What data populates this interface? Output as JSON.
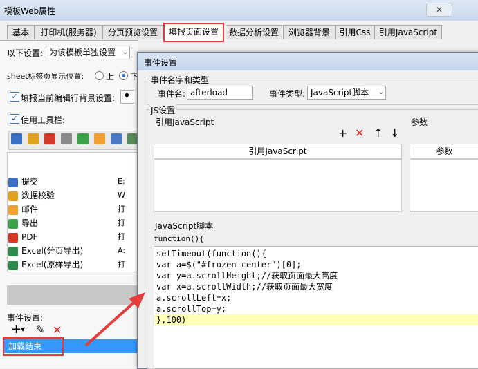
{
  "window": {
    "title": "模板Web属性",
    "close_label": "✕"
  },
  "tabs": [
    {
      "label": "基本"
    },
    {
      "label": "打印机(服务器)"
    },
    {
      "label": "分页预览设置"
    },
    {
      "label": "填报页面设置"
    },
    {
      "label": "数据分析设置"
    },
    {
      "label": "浏览器背景"
    },
    {
      "label": "引用Css"
    },
    {
      "label": "引用JavaScript"
    }
  ],
  "left_panel": {
    "settings_label": "以下设置:",
    "settings_select": "为该模板单独设置",
    "sheet_tab_label": "sheet标签页显示位置:",
    "radio_top": "上",
    "radio_bottom": "下",
    "fill_bg_label": "填报当前编辑行背景设置:",
    "use_toolbar_label": "使用工具栏:",
    "list_items": [
      {
        "label": "提交",
        "icon": "submit-icon",
        "color": "#3a6fc4"
      },
      {
        "label": "数据校验",
        "icon": "validate-icon",
        "color": "#e0a020"
      },
      {
        "label": "邮件",
        "icon": "mail-icon",
        "color": "#f0a030"
      },
      {
        "label": "导出",
        "icon": "export-icon",
        "color": "#3aa34a"
      },
      {
        "label": "PDF",
        "icon": "pdf-icon",
        "color": "#d43a2a"
      },
      {
        "label": "Excel(分页导出)",
        "icon": "excel-icon",
        "color": "#2e8b4a"
      },
      {
        "label": "Excel(原样导出)",
        "icon": "excel-icon",
        "color": "#2e8b4a"
      }
    ],
    "list_items_col2": [
      "E:",
      "W",
      "打",
      "打",
      "打",
      "A:",
      "打"
    ],
    "event_settings_label": "事件设置:",
    "event_item": "加载结束"
  },
  "dialog": {
    "title": "事件设置",
    "group_name_type": "事件名字和类型",
    "event_name_label": "事件名:",
    "event_name_value": "afterload",
    "event_type_label": "事件类型:",
    "event_type_value": "JavaScript脚本",
    "js_settings_title": "JS设置",
    "ref_js_label": "引用JavaScript",
    "params_label": "参数",
    "ref_js_header": "引用JavaScript",
    "params_header": "参数",
    "js_script_label": "JavaScript脚本",
    "function_header": "function(){",
    "code_lines": [
      "setTimeout(function(){",
      "var a=$(\"#frozen-center\")[0];",
      "var y=a.scrollHeight;//获取页面最大高度",
      "var x=a.scrollWidth;//获取页面最大宽度",
      "a.scrollLeft=x;",
      "a.scrollTop=y;",
      "},100)"
    ]
  }
}
